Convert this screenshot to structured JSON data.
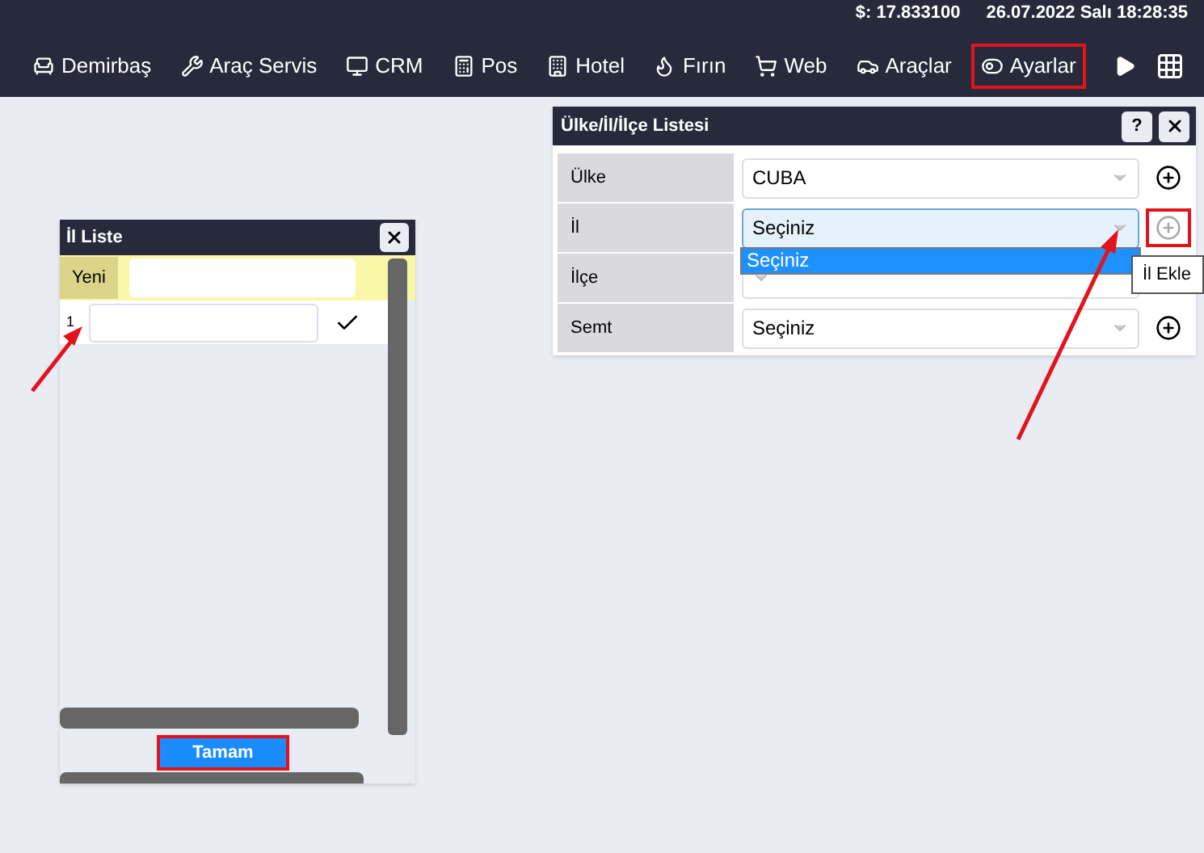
{
  "status": {
    "rate": "$: 17.833100",
    "datetime": "26.07.2022 Salı 18:28:35"
  },
  "menu": [
    {
      "label": "Demirbaş",
      "highlighted": false
    },
    {
      "label": "Araç Servis",
      "highlighted": false
    },
    {
      "label": "CRM",
      "highlighted": false
    },
    {
      "label": "Pos",
      "highlighted": false
    },
    {
      "label": "Hotel",
      "highlighted": false
    },
    {
      "label": "Fırın",
      "highlighted": false
    },
    {
      "label": "Web",
      "highlighted": false
    },
    {
      "label": "Araçlar",
      "highlighted": false
    },
    {
      "label": "Ayarlar",
      "highlighted": true
    }
  ],
  "il_liste": {
    "title": "İl Liste",
    "new_label": "Yeni",
    "rows": [
      {
        "number": "1"
      }
    ],
    "ok_button": {
      "label": "Tamam",
      "highlighted": true
    }
  },
  "location_dialog": {
    "title": "Ülke/İl/İlçe Listesi",
    "help_button": "?",
    "rows": [
      {
        "label": "Ülke",
        "value": "CUBA",
        "focused": false,
        "add_disabled": false,
        "add_highlighted": false
      },
      {
        "label": "İl",
        "value": "Seçiniz",
        "focused": true,
        "add_disabled": true,
        "add_highlighted": true
      },
      {
        "label": "İlçe",
        "focused": false
      },
      {
        "label": "Semt",
        "value": "Seçiniz",
        "focused": false,
        "add_disabled": false,
        "add_highlighted": false
      }
    ],
    "dropdown": [
      {
        "label": "Seçiniz",
        "selected": true
      }
    ],
    "tooltip": "İl Ekle"
  }
}
